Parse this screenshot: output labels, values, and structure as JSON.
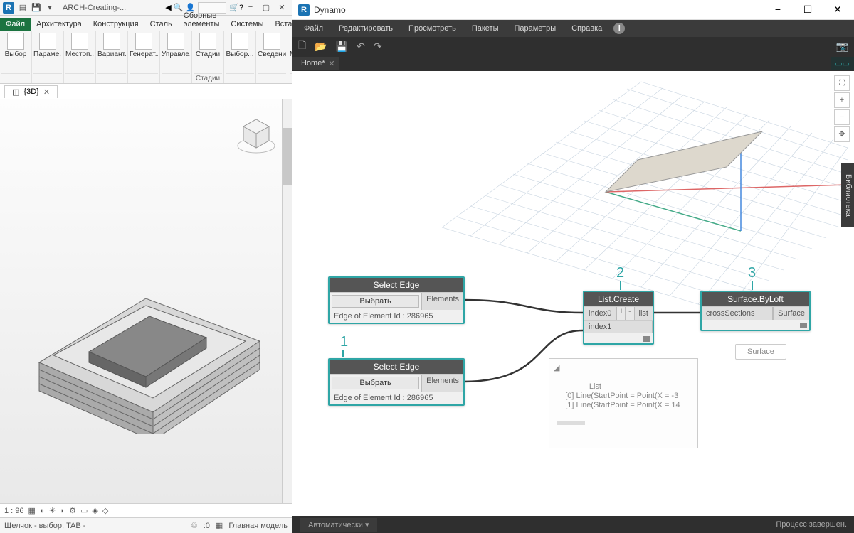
{
  "revit": {
    "doc_title": "ARCH-Creating-...",
    "file_tab": "Файл",
    "tabs": [
      "Архитектура",
      "Конструкция",
      "Сталь",
      "Сборные элементы",
      "Системы",
      "Вставить"
    ],
    "ribbon": [
      {
        "label": "Выбор",
        "group": ""
      },
      {
        "label": "Параме...",
        "group": ""
      },
      {
        "label": "Местоп...",
        "group": ""
      },
      {
        "label": "Вариант...",
        "group": ""
      },
      {
        "label": "Генерат...",
        "group": ""
      },
      {
        "label": "Управле...",
        "group": ""
      },
      {
        "label": "Стадии",
        "group": "Стадии"
      },
      {
        "label": "Выбор...",
        "group": ""
      },
      {
        "label": "Сведения",
        "group": ""
      },
      {
        "label": "Макросы",
        "group": ""
      }
    ],
    "view_name": "{3D}",
    "scale": "1 : 96",
    "status": "Щелчок - выбор, TAB - ",
    "workset": "Главная модель"
  },
  "dynamo": {
    "title": "Dynamo",
    "menu": [
      "Файл",
      "Редактировать",
      "Просмотреть",
      "Пакеты",
      "Параметры",
      "Справка"
    ],
    "tab": "Home*",
    "library": "Библиотека",
    "run_mode": "Автоматически ▾",
    "status": "Процесс завершен.",
    "annotations": [
      "1",
      "2",
      "3"
    ],
    "nodes": {
      "select1": {
        "title": "Select Edge",
        "button": "Выбрать",
        "port": "Elements",
        "info": "Edge of Element Id : 286965"
      },
      "select2": {
        "title": "Select Edge",
        "button": "Выбрать",
        "port": "Elements",
        "info": "Edge of Element Id : 286965"
      },
      "list": {
        "title": "List.Create",
        "in0": "index0",
        "in1": "index1",
        "plus": "+",
        "minus": "-",
        "out": "list"
      },
      "loft": {
        "title": "Surface.ByLoft",
        "in": "crossSections",
        "out": "Surface",
        "pill": "Surface"
      }
    },
    "preview": "  List\n    [0] Line(StartPoint = Point(X = -3\n    [1] Line(StartPoint = Point(X = 14"
  }
}
